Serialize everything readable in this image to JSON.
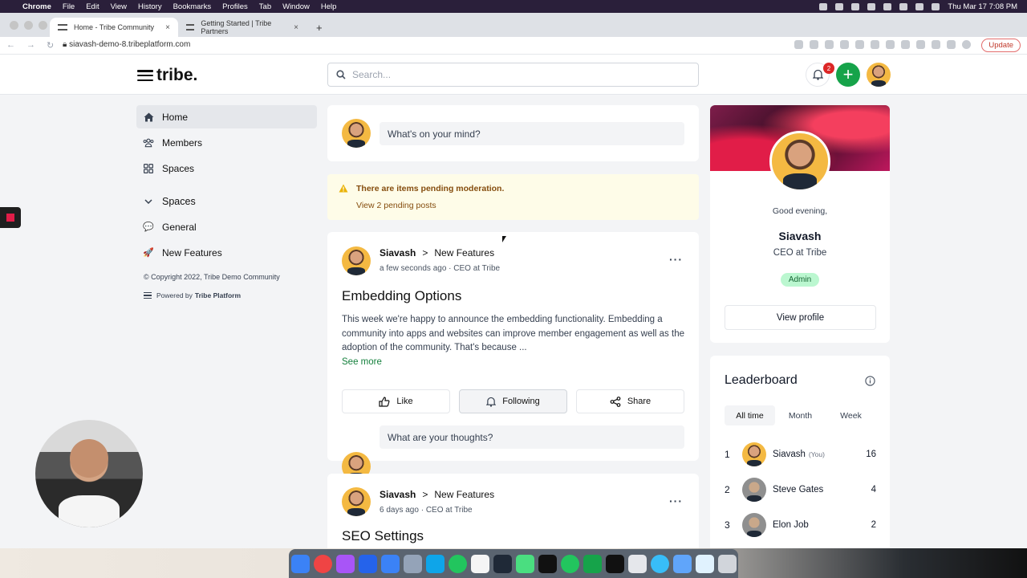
{
  "macos": {
    "menus": [
      "Chrome",
      "File",
      "Edit",
      "View",
      "History",
      "Bookmarks",
      "Profiles",
      "Tab",
      "Window",
      "Help"
    ],
    "clock": "Thu Mar 17  7:08 PM"
  },
  "browser": {
    "tabs": [
      {
        "title": "Home - Tribe Community",
        "close": "×"
      },
      {
        "title": "Getting Started | Tribe Partners",
        "close": "×"
      }
    ],
    "new_tab": "+",
    "url": "siavash-demo-8.tribeplatform.com",
    "update_label": "Update"
  },
  "header": {
    "logo_text": "tribe.",
    "search_placeholder": "Search...",
    "notification_count": "2",
    "create_label": "+"
  },
  "sidebar": {
    "items": [
      {
        "label": "Home",
        "icon": "home-icon"
      },
      {
        "label": "Members",
        "icon": "members-icon"
      },
      {
        "label": "Spaces",
        "icon": "grid-icon"
      }
    ],
    "spaces_header": "Spaces",
    "spaces": [
      {
        "label": "General",
        "icon": "speech-bubble-icon",
        "emoji": "💬"
      },
      {
        "label": "New Features",
        "icon": "rocket-icon",
        "emoji": "🚀"
      }
    ],
    "copyright": "© Copyright 2022, Tribe Demo Community",
    "powered_by": "Powered by",
    "powered_brand": "Tribe Platform"
  },
  "composer": {
    "placeholder": "What's on your mind?"
  },
  "moderation": {
    "message": "There are items pending moderation.",
    "link": "View 2 pending posts"
  },
  "posts": [
    {
      "author": "Siavash",
      "separator": ">",
      "space": "New Features",
      "meta": "a few seconds ago · CEO at Tribe",
      "title": "Embedding Options",
      "body": "This week we're happy to announce the embedding functionality. Embedding a community into apps and websites can improve member engagement as well as the adoption of the community. That's because ...",
      "see_more": "See more",
      "actions": {
        "like": "Like",
        "following": "Following",
        "share": "Share"
      },
      "reply_placeholder": "What are your thoughts?"
    },
    {
      "author": "Siavash",
      "separator": ">",
      "space": "New Features",
      "meta": "6 days ago · CEO at Tribe",
      "title": "SEO Settings"
    }
  ],
  "profile_card": {
    "greeting": "Good evening,",
    "name": "Siavash",
    "title": "CEO at Tribe",
    "role": "Admin",
    "view_profile": "View profile"
  },
  "leaderboard": {
    "title": "Leaderboard",
    "tabs": [
      "All time",
      "Month",
      "Week"
    ],
    "selected_tab": "All time",
    "rows": [
      {
        "rank": "1",
        "name": "Siavash",
        "you": "(You)",
        "score": "16"
      },
      {
        "rank": "2",
        "name": "Steve Gates",
        "you": "",
        "score": "4"
      },
      {
        "rank": "3",
        "name": "Elon Job",
        "you": "",
        "score": "2"
      }
    ]
  },
  "colors": {
    "brand_green": "#16a34a",
    "alert_bg": "#fefce8",
    "alert_text": "#854d0e",
    "admin_badge": "#bbf7d0",
    "notification_red": "#dc2626"
  }
}
